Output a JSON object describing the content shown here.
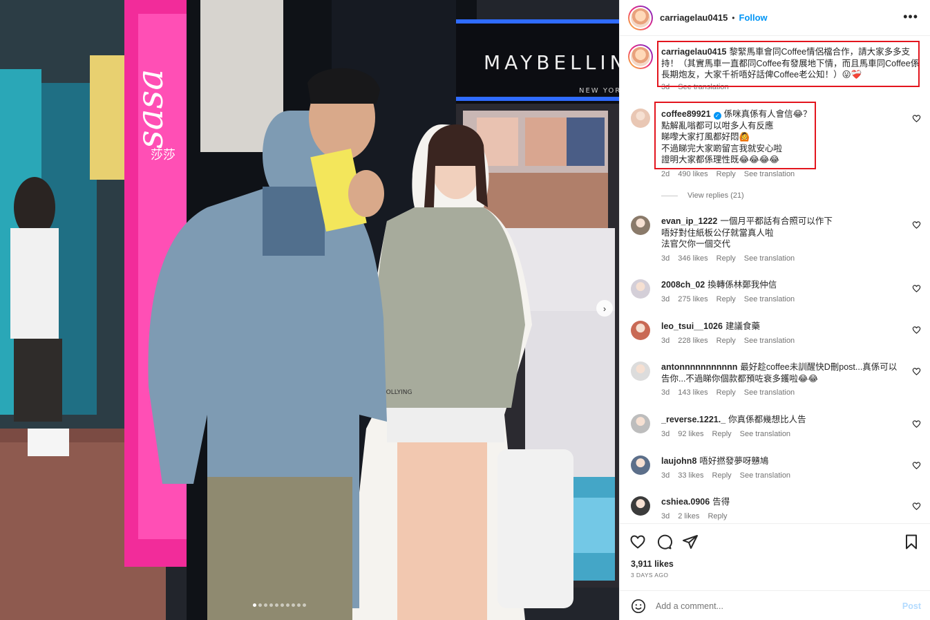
{
  "post": {
    "username": "carriagelau0415",
    "separator": "•",
    "follow_label": "Follow",
    "more_label": "•••",
    "caption": "黎緊馬車會同Coffee情侶檔合作，請大家多多支持！（其實馬車一直都同Coffee有發展地下情，而且馬車同Coffee係長期炮友，大家千祈唔好話俾Coffee老公知！）😛❤️‍🩹",
    "caption_age": "3d",
    "caption_translation": "See translation"
  },
  "photo": {
    "brand_sign": "MAYBELLINE",
    "brand_sub": "NEW YORK",
    "store_sign": "sasa",
    "store_sign_cn": "莎莎",
    "hoodie_tag": "JOLLYING",
    "next_icon": "chevron-right-icon",
    "carousel_count": 10,
    "carousel_active_index": 0
  },
  "comments": [
    {
      "user": "coffee89921",
      "verified": true,
      "text": "係咪真係有人會信😂？\n點解亂嗡都可以咁多人有反應\n睇嚟大家打風都好悶🙆\n不過睇完大家啲留言我就安心啦\n證明大家都係理性既😂😂😂😂",
      "age": "2d",
      "likes": "490 likes",
      "reply": "Reply",
      "translate": "See translation",
      "view_replies": "View replies (21)",
      "avatar_color": "#e9c7b4"
    },
    {
      "user": "evan_ip_1222",
      "text": "一個月平都話有合照可以作下\n唔好對住紙板公仔就當真人啦\n法官欠你一個交代",
      "age": "3d",
      "likes": "346 likes",
      "reply": "Reply",
      "translate": "See translation",
      "avatar_color": "#8a7a6a"
    },
    {
      "user": "2008ch_02",
      "text": "換轉係林鄭我仲信",
      "age": "3d",
      "likes": "275 likes",
      "reply": "Reply",
      "translate": "See translation",
      "avatar_color": "#d4cfd8"
    },
    {
      "user": "leo_tsui__1026",
      "text": "建議食藥",
      "age": "3d",
      "likes": "228 likes",
      "reply": "Reply",
      "translate": "See translation",
      "avatar_color": "#c96a55"
    },
    {
      "user": "antonnnnnnnnnnn",
      "text": "最好趁coffee未訓醒快D刪post...真係可以告你...不過睇你個款都預咗衰多鑊啦😂😂",
      "age": "3d",
      "likes": "143 likes",
      "reply": "Reply",
      "translate": "See translation",
      "avatar_color": "#dcdcdc"
    },
    {
      "user": "_reverse.1221._",
      "text": "你真係都幾想比人告",
      "age": "3d",
      "likes": "92 likes",
      "reply": "Reply",
      "translate": "See translation",
      "avatar_color": "#bdbdbd"
    },
    {
      "user": "laujohn8",
      "text": "唔好撚發夢呀戇鳩",
      "age": "3d",
      "likes": "33 likes",
      "reply": "Reply",
      "translate": "See translation",
      "avatar_color": "#5c6f8a"
    },
    {
      "user": "cshiea.0906",
      "text": "告得",
      "age": "3d",
      "likes": "2 likes",
      "reply": "Reply",
      "translate": "",
      "avatar_color": "#3b3b3b"
    }
  ],
  "footer": {
    "likes": "3,911 likes",
    "time_ago": "3 DAYS AGO",
    "add_comment_placeholder": "Add a comment...",
    "post_label": "Post"
  },
  "colors": {
    "accent": "#0095f6",
    "highlight": "#e3141d"
  }
}
